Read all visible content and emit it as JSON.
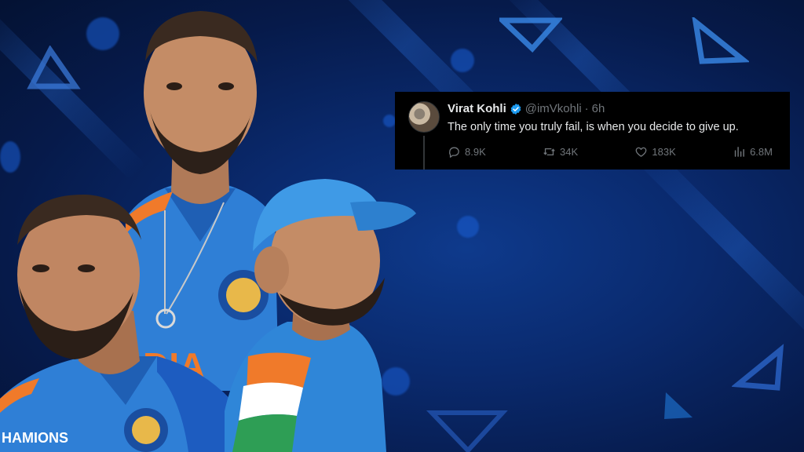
{
  "tweet": {
    "name": "Virat Kohli",
    "handle": "@imVkohli",
    "separator": "·",
    "time": "6h",
    "text": "The only time you truly fail, is when you decide to give up.",
    "replies": "8.9K",
    "reposts": "34K",
    "likes": "183K",
    "views": "6.8M",
    "icons": {
      "verified": "verified-badge-icon",
      "replies": "reply-icon",
      "reposts": "repost-icon",
      "likes": "heart-icon",
      "views": "views-icon"
    }
  },
  "colors": {
    "background": "#0a2a6e",
    "card": "#000000",
    "verified": "#1d9bf0",
    "muted": "#71767b",
    "jersey": "#2f7fd6"
  }
}
